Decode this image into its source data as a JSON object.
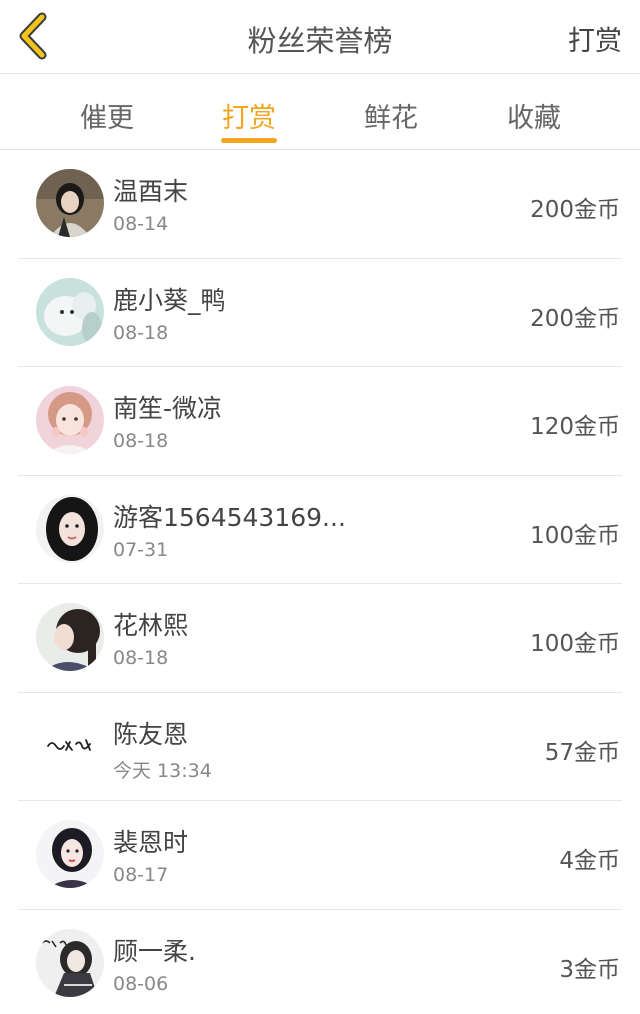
{
  "header": {
    "title": "粉丝荣誉榜",
    "action_label": "打赏",
    "back_icon": "chevron-left-icon",
    "back_icon_color": "#f2c51e"
  },
  "tabs": [
    {
      "label": "催更"
    },
    {
      "label": "打赏"
    },
    {
      "label": "鲜花"
    },
    {
      "label": "收藏"
    }
  ],
  "active_tab": "打赏",
  "accent_color": "#f2a51e",
  "list": [
    {
      "name": "温酉末",
      "date": "08-14",
      "amount": "200金币"
    },
    {
      "name": "鹿小葵_鸭",
      "date": "08-18",
      "amount": "200金币"
    },
    {
      "name": "南笙-微凉",
      "date": "08-18",
      "amount": "120金币"
    },
    {
      "name": "游客1564543169...",
      "date": "07-31",
      "amount": "100金币"
    },
    {
      "name": "花林熙",
      "date": "08-18",
      "amount": "100金币"
    },
    {
      "name": "陈友恩",
      "date": "今天 13:34",
      "amount": "57金币"
    },
    {
      "name": "裴恩时",
      "date": "08-17",
      "amount": "4金币"
    },
    {
      "name": "顾一柔.",
      "date": "08-06",
      "amount": "3金币"
    }
  ]
}
